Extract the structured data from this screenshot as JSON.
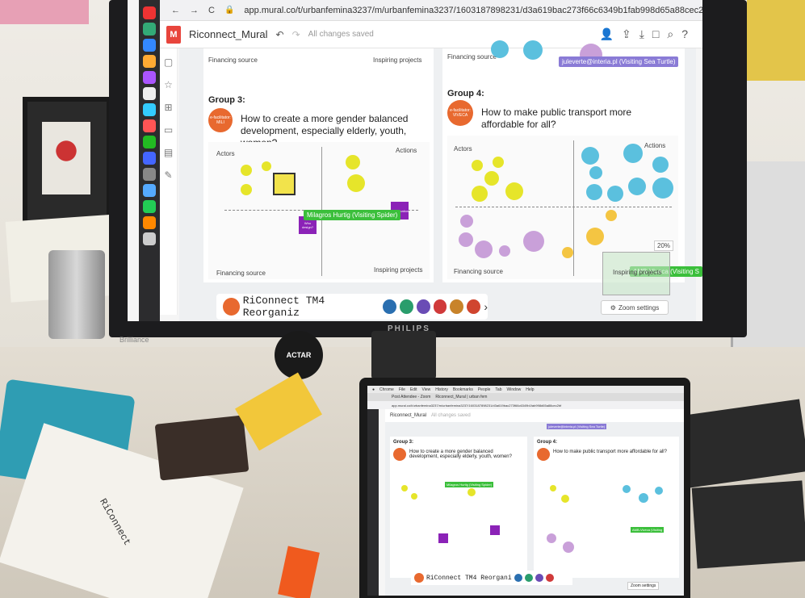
{
  "browser": {
    "url": "app.mural.co/t/urbanfemina3237/m/urbanfemina3237/1603187898231/d3a619bac273f66c6349b1fab998d65a88cec2bf"
  },
  "mural": {
    "logo_letter": "M",
    "title": "Riconnect_Mural",
    "status": "All changes saved"
  },
  "top_labels": {
    "left_financing": "Financing source",
    "left_inspiring": "Inspiring projects",
    "right_financing": "Financing source",
    "visitor_tag": "juleverte@interia.pl (Visiting Sea Turtle)"
  },
  "group3": {
    "title": "Group 3:",
    "facilitator": "e-facilitator: MILI",
    "question": "How to create a more gender balanced development, especially elderly, youth, women?",
    "actors": "Actors",
    "actions": "Actions",
    "financing": "Financing source",
    "inspiring": "Inspiring projects",
    "cursor_user": "Milagros Hurtig (Visiting Spider)",
    "sticky_who": "Who design?",
    "sticky_participation": "Participation"
  },
  "group4": {
    "title": "Group 4:",
    "facilitator": "e-facilitator: VIVECA",
    "question": "How to make public transport more affordable for all?",
    "actors": "Actors",
    "actions": "Actions",
    "financing": "Financing source",
    "inspiring": "Inspiring projects",
    "cursor_user": "AMB-Viveca (Visiting S"
  },
  "frames": {
    "label": "RiConnect TM4 Reorganiz"
  },
  "zoom": {
    "percent": "20%",
    "settings": "Zoom settings"
  },
  "monitor_brand": "PHILIPS",
  "monitor_model": "Brilliance",
  "sticker_text": "ACTAR",
  "laptop": {
    "menu": [
      "Chrome",
      "File",
      "Edit",
      "View",
      "History",
      "Bookmarks",
      "People",
      "Tab",
      "Window",
      "Help"
    ],
    "tab1": "Post Attendee - Zoom",
    "tab2": "Riconnect_Mural | urban fem",
    "title": "Riconnect_Mural",
    "status": "All changes saved",
    "group3_title": "Group 3:",
    "group3_question": "How to create a more gender balanced development, especially elderly, youth, women?",
    "group4_title": "Group 4:",
    "group4_question": "How to make public transport more affordable for all?",
    "cursor_user": "Milagros Hurtig (Visiting Spider)",
    "cursor_user2": "AMB-Viveca (Visiting",
    "visitor_tag": "juleverte@interia.pl (Visiting Sea Turtle)",
    "frames_label": "RiConnect TM4 Reorgani",
    "zoom_settings": "Zoom settings"
  },
  "paper_text": "RiConnect"
}
